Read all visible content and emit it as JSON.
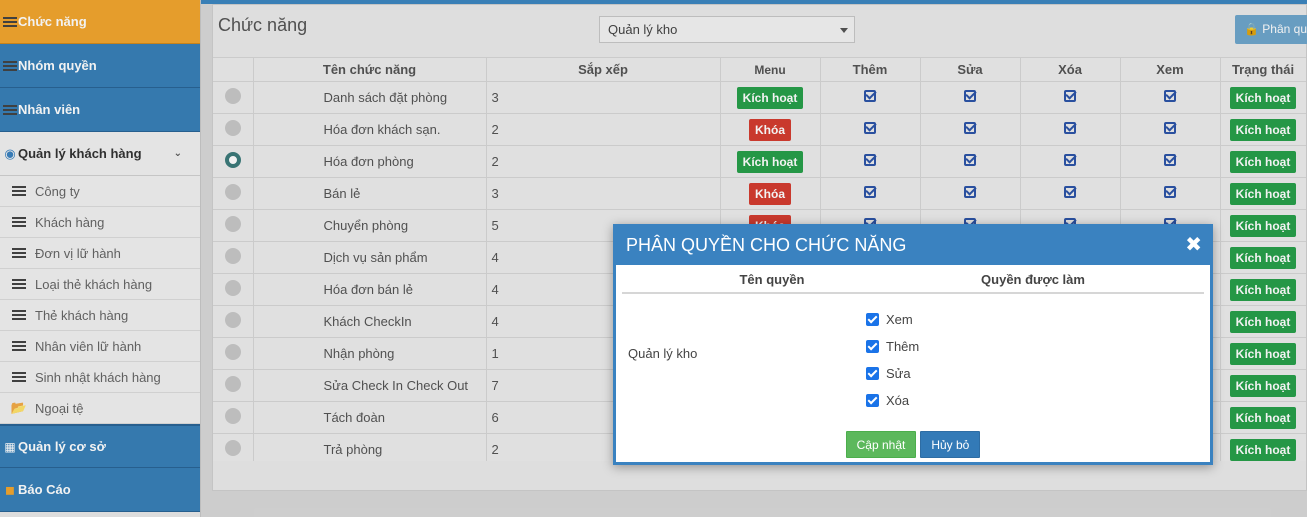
{
  "sidebar": {
    "items": [
      {
        "label": "Chức năng",
        "icon": "list-icon",
        "style": "orange"
      },
      {
        "label": "Nhóm quyền",
        "icon": "list-icon",
        "style": "blue"
      },
      {
        "label": "Nhân viên",
        "icon": "list-icon",
        "style": "blue"
      },
      {
        "label": "Quản lý khách hàng",
        "icon": "users-icon",
        "style": "open"
      }
    ],
    "subitems": [
      {
        "label": "Công ty",
        "icon": "list-icon"
      },
      {
        "label": "Khách hàng",
        "icon": "list-icon"
      },
      {
        "label": "Đơn vị lữ hành",
        "icon": "list-icon"
      },
      {
        "label": "Loại thẻ khách hàng",
        "icon": "list-icon"
      },
      {
        "label": "Thẻ khách hàng",
        "icon": "list-icon"
      },
      {
        "label": "Nhân viên lữ hành",
        "icon": "list-icon"
      },
      {
        "label": "Sinh nhật khách hàng",
        "icon": "list-icon"
      },
      {
        "label": "Ngoại tệ",
        "icon": "folder-open-icon"
      }
    ],
    "bottom_items": [
      {
        "label": "Quản lý cơ sở",
        "icon": "book-icon"
      },
      {
        "label": "Báo Cáo",
        "icon": "chart-icon"
      }
    ]
  },
  "main": {
    "title": "Chức năng",
    "select_value": "Quản lý kho",
    "perm_button_label": "Phân quyền"
  },
  "table": {
    "headers": [
      "",
      "Tên chức năng",
      "Sắp xếp",
      "Menu",
      "Thêm",
      "Sửa",
      "Xóa",
      "Xem",
      "Trạng thái"
    ],
    "rows": [
      {
        "name": "Danh sách đặt phòng",
        "order": "3",
        "menu": "Kích hoạt",
        "menu_state": "active",
        "selected": false,
        "status": "Kích hoạt"
      },
      {
        "name": "Hóa đơn khách sạn.",
        "order": "2",
        "menu": "Khóa",
        "menu_state": "locked",
        "selected": false,
        "status": "Kích hoạt"
      },
      {
        "name": "Hóa đơn phòng",
        "order": "2",
        "menu": "Kích hoạt",
        "menu_state": "active",
        "selected": true,
        "status": "Kích hoạt"
      },
      {
        "name": "Bán lẻ",
        "order": "3",
        "menu": "Khóa",
        "menu_state": "locked",
        "selected": false,
        "status": "Kích hoạt"
      },
      {
        "name": "Chuyển phòng",
        "order": "5",
        "menu": "Khóa",
        "menu_state": "locked",
        "selected": false,
        "status": "Kích hoạt"
      },
      {
        "name": "Dịch vụ sản phẩm",
        "order": "4",
        "menu": "",
        "menu_state": "hidden",
        "selected": false,
        "status": "Kích hoạt"
      },
      {
        "name": "Hóa đơn bán lẻ",
        "order": "4",
        "menu": "",
        "menu_state": "hidden",
        "selected": false,
        "status": "Kích hoạt"
      },
      {
        "name": "Khách CheckIn",
        "order": "4",
        "menu": "",
        "menu_state": "hidden",
        "selected": false,
        "status": "Kích hoạt"
      },
      {
        "name": "Nhận phòng",
        "order": "1",
        "menu": "",
        "menu_state": "hidden",
        "selected": false,
        "status": "Kích hoạt"
      },
      {
        "name": "Sửa Check In Check Out",
        "order": "7",
        "menu": "",
        "menu_state": "hidden",
        "selected": false,
        "status": "Kích hoạt"
      },
      {
        "name": "Tách đoàn",
        "order": "6",
        "menu": "",
        "menu_state": "hidden",
        "selected": false,
        "status": "Kích hoạt"
      },
      {
        "name": "Trả phòng",
        "order": "2",
        "menu": "",
        "menu_state": "hidden",
        "selected": false,
        "status": "Kích hoạt"
      }
    ]
  },
  "modal": {
    "title": "PHÂN QUYỀN CHO CHỨC NĂNG",
    "col_name": "Tên quyền",
    "col_perms": "Quyền được làm",
    "row_label": "Quản lý kho",
    "permissions": [
      {
        "label": "Xem",
        "checked": true
      },
      {
        "label": "Thêm",
        "checked": true
      },
      {
        "label": "Sửa",
        "checked": true
      },
      {
        "label": "Xóa",
        "checked": true
      }
    ],
    "update_label": "Cập nhật",
    "cancel_label": "Hủy bỏ"
  },
  "colors": {
    "primary": "#3a82c0",
    "accent_orange": "#f2a62f",
    "success": "#27a04a",
    "danger": "#d43d30"
  }
}
